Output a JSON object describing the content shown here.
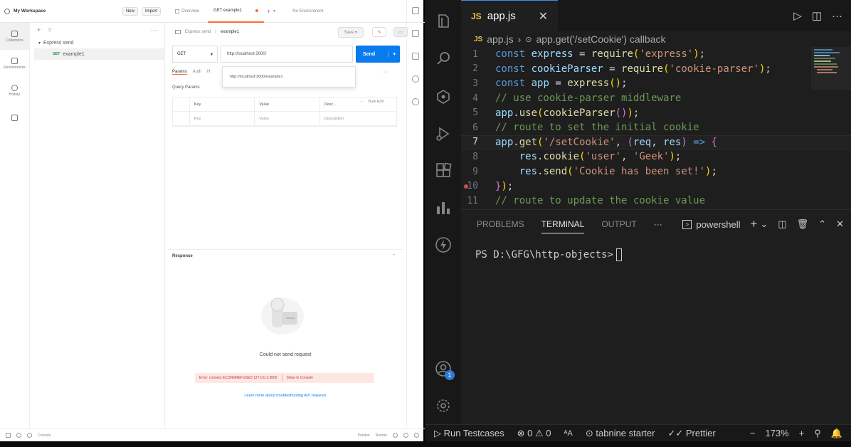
{
  "postman": {
    "workspace_title": "My Workspace",
    "new_label": "New",
    "import_label": "Import",
    "rail": [
      {
        "label": "Collections",
        "icon": "collections-icon"
      },
      {
        "label": "Environments",
        "icon": "environments-icon"
      },
      {
        "label": "History",
        "icon": "history-icon"
      },
      {
        "label": "",
        "icon": "apis-icon"
      }
    ],
    "tree": {
      "collection": "Express send",
      "request_method": "GET",
      "request_name": "example1"
    },
    "tabs": {
      "overview": "Overview",
      "active": "GET example1",
      "environment": "No Environment"
    },
    "breadcrumb": {
      "parent": "Express send",
      "current": "example1"
    },
    "save_label": "Save",
    "method": "GET",
    "url": "http://localhost:3000/",
    "send_label": "Send",
    "suggestion": "http://localhost:3000/example1",
    "sub_tabs": [
      "Params",
      "Auth",
      "H"
    ],
    "query_params_label": "Query Params",
    "table_headers": [
      "Key",
      "Value",
      "Desc..."
    ],
    "table_placeholders": [
      "Key",
      "Value",
      "Description"
    ],
    "bulk_edit": "Bulk Edit",
    "response_label": "Response",
    "error_title": "Could not send request",
    "error_detail": "Error: connect ECONNREFUSED 127.0.0.1:3000",
    "error_action": "Show in Console",
    "learn_link": "Learn more about troubleshooting API requests",
    "status": {
      "console": "Console",
      "postbot": "Postbot",
      "runner": "Runner"
    }
  },
  "vscode": {
    "tab_badge": "JS",
    "tab_name": "app.js",
    "breadcrumb": [
      "app.js",
      "app.get('/setCookie') callback"
    ],
    "lines": [
      {
        "n": "1",
        "cur": false,
        "bp": false
      },
      {
        "n": "2",
        "cur": false,
        "bp": false
      },
      {
        "n": "3",
        "cur": false,
        "bp": false
      },
      {
        "n": "4",
        "cur": false,
        "bp": false
      },
      {
        "n": "5",
        "cur": false,
        "bp": false
      },
      {
        "n": "6",
        "cur": false,
        "bp": false
      },
      {
        "n": "7",
        "cur": true,
        "bp": false
      },
      {
        "n": "8",
        "cur": false,
        "bp": false
      },
      {
        "n": "9",
        "cur": false,
        "bp": false
      },
      {
        "n": "10",
        "cur": false,
        "bp": true
      },
      {
        "n": "11",
        "cur": false,
        "bp": false
      }
    ],
    "panel_tabs": [
      "PROBLEMS",
      "TERMINAL",
      "OUTPUT"
    ],
    "active_panel": "TERMINAL",
    "shell": "powershell",
    "prompt": "PS D:\\GFG\\http-objects>",
    "status": {
      "run": "Run Testcases",
      "errors": "0",
      "warnings": "0",
      "tabnine": "tabnine starter",
      "prettier": "Prettier",
      "zoom": "173%"
    },
    "badge_count": "1"
  }
}
